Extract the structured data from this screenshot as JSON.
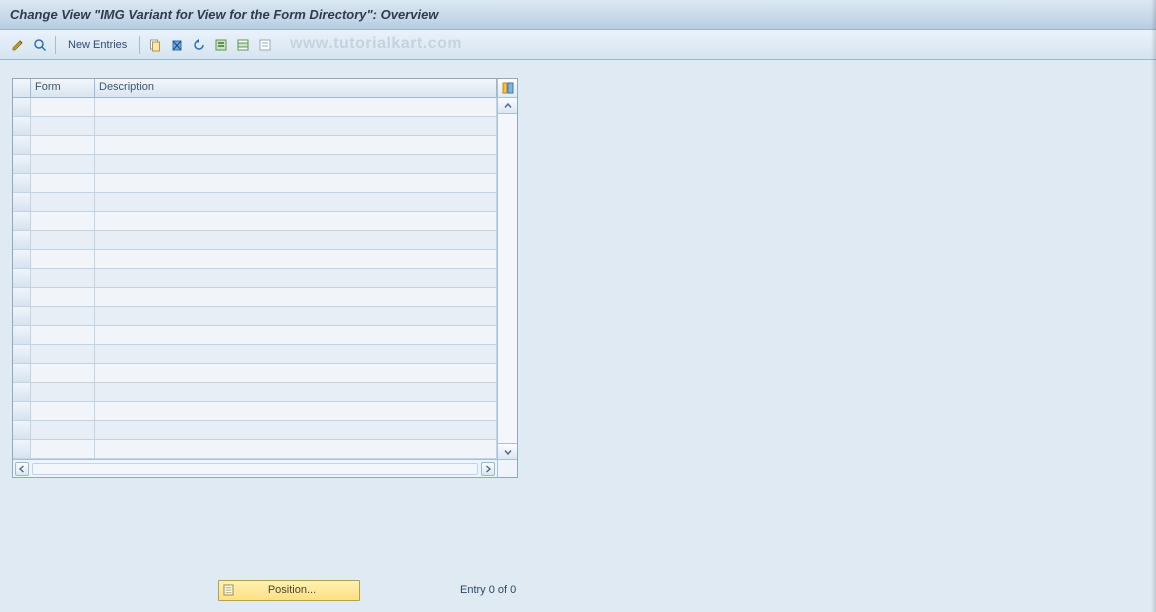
{
  "title": "Change View \"IMG Variant for View for the Form Directory\": Overview",
  "watermark": "www.tutorialkart.com",
  "toolbar": {
    "new_entries_label": "New Entries"
  },
  "table": {
    "columns": {
      "form": "Form",
      "description": "Description"
    },
    "row_count": 19,
    "rows": []
  },
  "footer": {
    "position_label": "Position...",
    "entry_status": "Entry 0 of 0"
  }
}
